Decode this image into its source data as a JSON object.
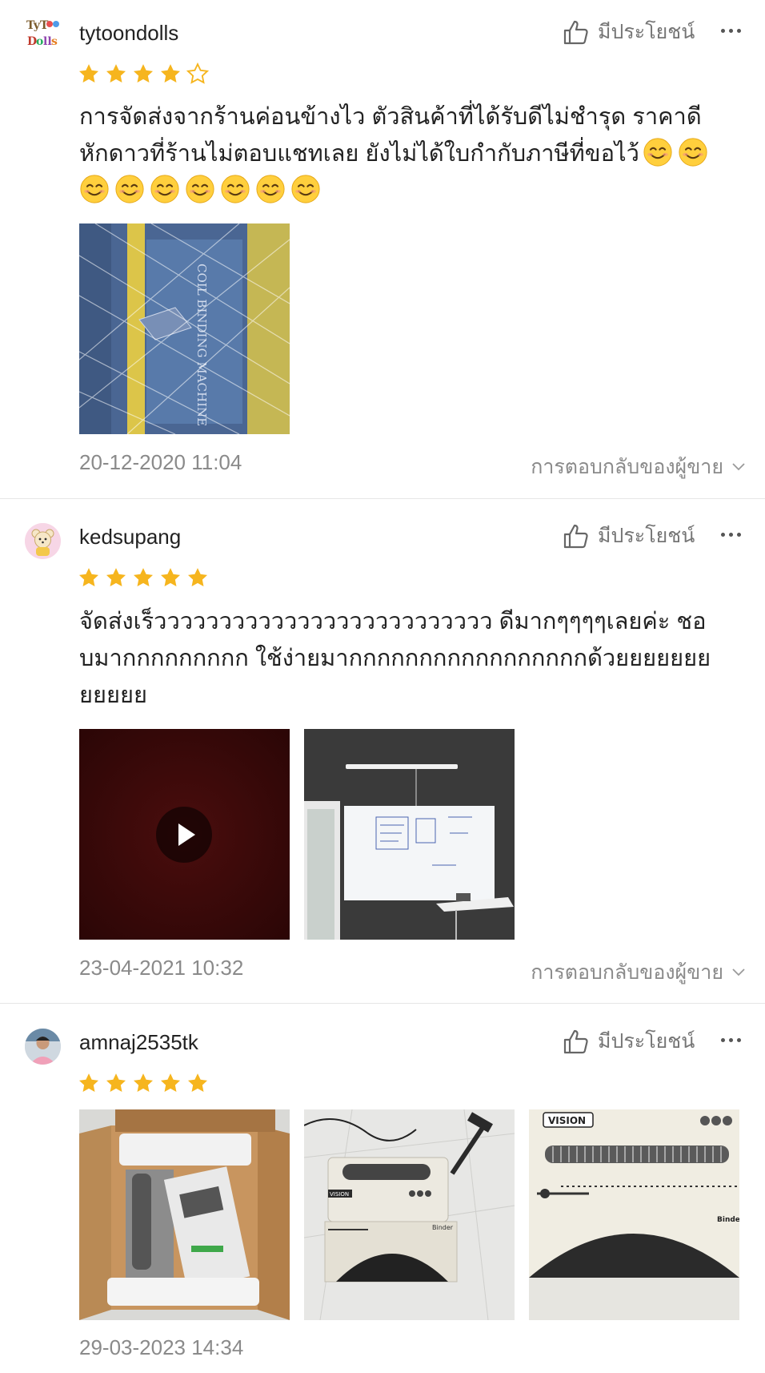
{
  "colors": {
    "star": "#f6b51e",
    "text": "#222222",
    "muted": "#8a8a8a",
    "divider": "#e6e6e6"
  },
  "reviews": [
    {
      "username": "tytoondolls",
      "avatar_icon": "tytoondolls-logo",
      "helpful_label": "มีประโยชน์",
      "rating": 4,
      "comment_line1": "การจัดส่งจากร้านค่อนข้างไว ตัวสินค้าที่ได้รับดีไม่ชำรุด  ราคาดี",
      "comment_line2": "หักดาวที่ร้านไม่ตอบแชทเลย ยังไม่ได้ใบกำกับภาษีที่ขอไว้",
      "emoji_icon": "smiling-face-emoji",
      "photos": [
        "binding-machine-box-wrapped"
      ],
      "date": "20-12-2020 11:04",
      "reply_label": "การตอบกลับของผู้ขาย"
    },
    {
      "username": "kedsupang",
      "avatar_icon": "bear-avatar",
      "helpful_label": "มีประโยชน์",
      "rating": 5,
      "comment": "จัดส่งเร็วววววววววววววววววววววววววว ดีมากๆๆๆๆเลยค่ะ ชอบมากกกกกกกกก ใช้ง่ายมากกกกกกกกกกกกกกกกกด้วยยยยยยยยยยยย",
      "photos": [
        "video-thumbnail-dark-red",
        "whiteboard-room"
      ],
      "date": "23-04-2021 10:32",
      "reply_label": "การตอบกลับของผู้ขาย"
    },
    {
      "username": "amnaj2535tk",
      "avatar_icon": "person-avatar",
      "helpful_label": "มีประโยชน์",
      "rating": 5,
      "photos": [
        "opened-box",
        "binding-machine-floor",
        "binding-machine-closeup"
      ],
      "photo_text": {
        "vision": "VISION",
        "binder": "Binder"
      },
      "date": "29-03-2023 14:34"
    }
  ]
}
